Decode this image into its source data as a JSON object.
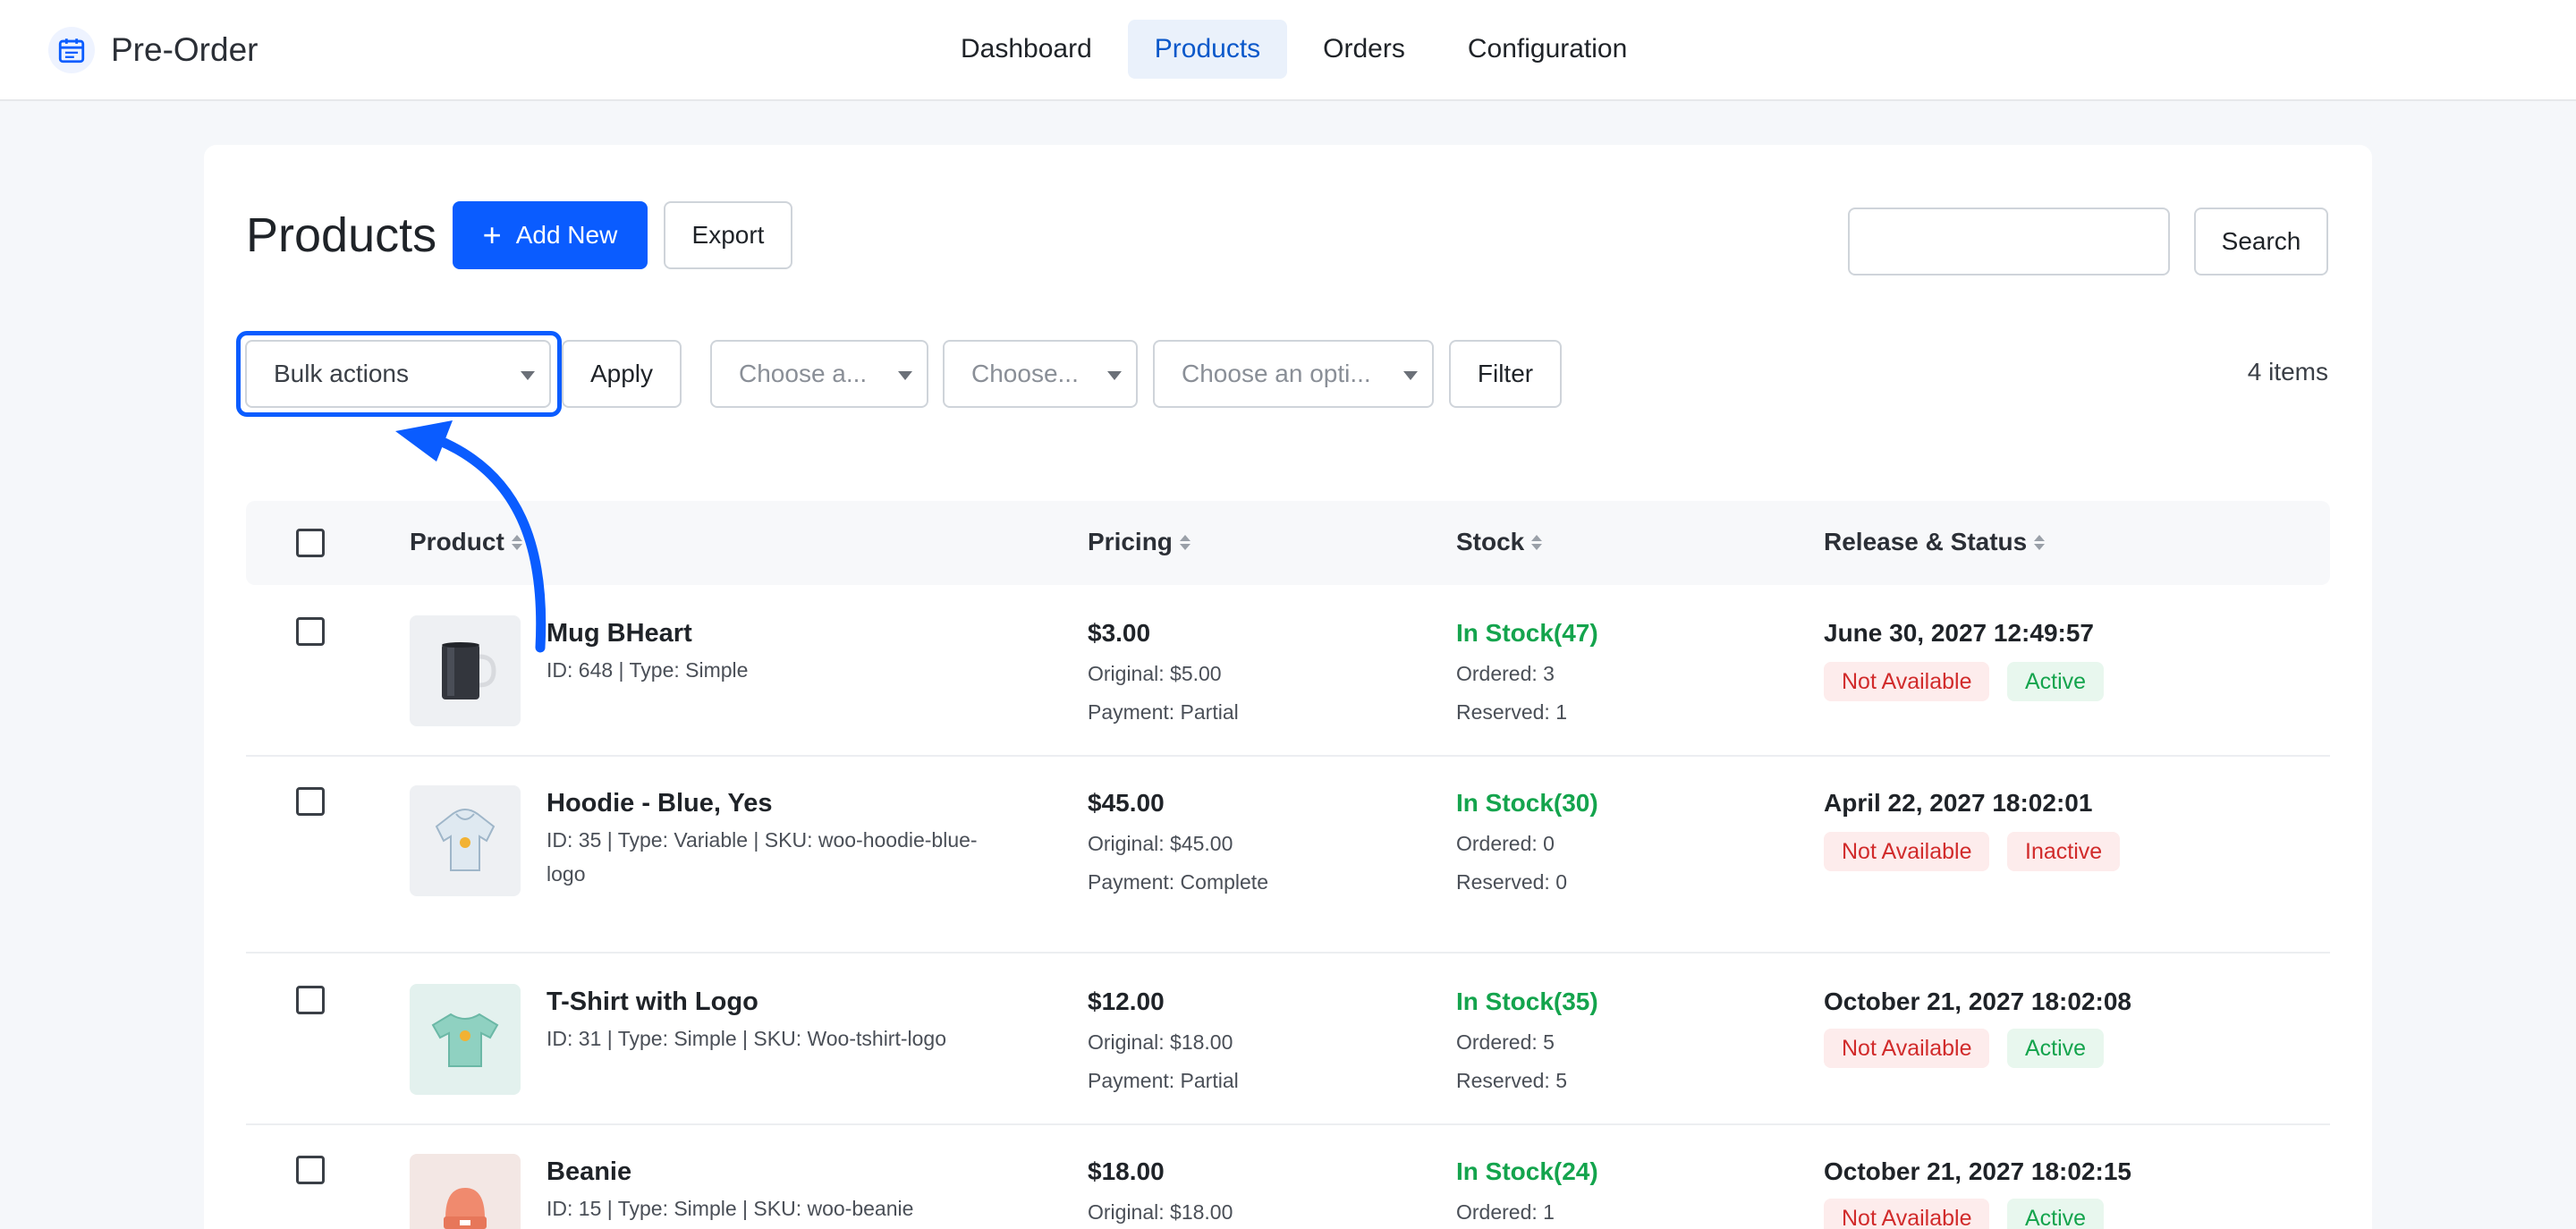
{
  "app": {
    "name": "Pre-Order",
    "icon": "calendar-icon"
  },
  "nav": [
    {
      "label": "Dashboard",
      "active": false
    },
    {
      "label": "Products",
      "active": true
    },
    {
      "label": "Orders",
      "active": false
    },
    {
      "label": "Configuration",
      "active": false
    }
  ],
  "page": {
    "title": "Products"
  },
  "toolbar": {
    "add_new_label": "Add New",
    "export_label": "Export",
    "search_value": "",
    "search_label": "Search"
  },
  "filters": {
    "bulk_actions": "Bulk actions",
    "apply_label": "Apply",
    "select_1": "Choose a...",
    "select_2": "Choose...",
    "select_3": "Choose an opti...",
    "filter_label": "Filter",
    "items_count": "4 items"
  },
  "table": {
    "headers": {
      "product": "Product",
      "pricing": "Pricing",
      "stock": "Stock",
      "release_status": "Release & Status"
    },
    "rows": [
      {
        "name": "Mug BHeart",
        "meta": "ID: 648 | Type: Simple",
        "price": "$3.00",
        "original": "Original: $5.00",
        "payment": "Payment: Partial",
        "stock": "In Stock(47)",
        "ordered": "Ordered: 3",
        "reserved": "Reserved: 1",
        "release": "June 30, 2027 12:49:57",
        "availability": "Not Available",
        "status": "Active"
      },
      {
        "name": "Hoodie - Blue, Yes",
        "meta": "ID: 35 | Type: Variable | SKU: woo-hoodie-blue-logo",
        "price": "$45.00",
        "original": "Original: $45.00",
        "payment": "Payment: Complete",
        "stock": "In Stock(30)",
        "ordered": "Ordered: 0",
        "reserved": "Reserved: 0",
        "release": "April 22, 2027 18:02:01",
        "availability": "Not Available",
        "status": "Inactive"
      },
      {
        "name": "T-Shirt with Logo",
        "meta": "ID: 31 | Type: Simple | SKU: Woo-tshirt-logo",
        "price": "$12.00",
        "original": "Original: $18.00",
        "payment": "Payment: Partial",
        "stock": "In Stock(35)",
        "ordered": "Ordered: 5",
        "reserved": "Reserved: 5",
        "release": "October 21, 2027 18:02:08",
        "availability": "Not Available",
        "status": "Active"
      },
      {
        "name": "Beanie",
        "meta": "ID: 15 | Type: Simple | SKU: woo-beanie",
        "price": "$18.00",
        "original": "Original: $18.00",
        "payment": "",
        "stock": "In Stock(24)",
        "ordered": "Ordered: 1",
        "reserved": "",
        "release": "October 21, 2027 18:02:15",
        "availability": "Not Available",
        "status": "Active"
      }
    ]
  },
  "colors": {
    "accent": "#0a5cff",
    "in_stock": "#14a44d",
    "danger": "#d12b2b"
  }
}
